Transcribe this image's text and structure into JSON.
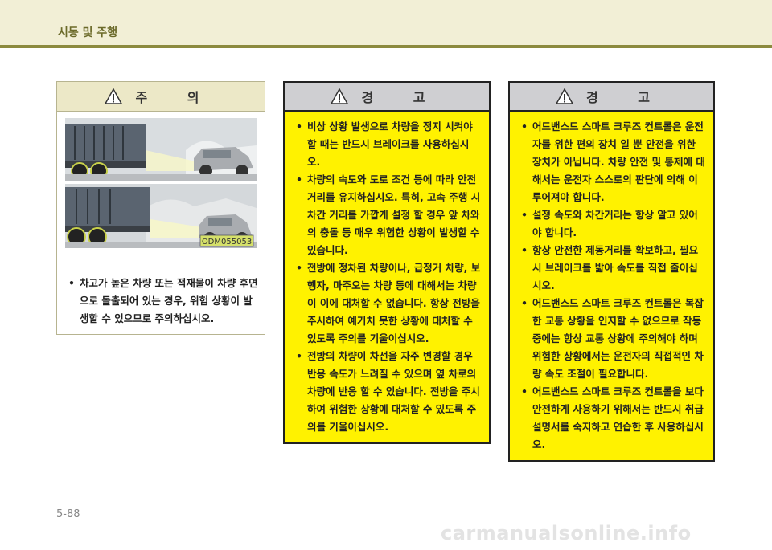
{
  "header": {
    "section_title": "시동 및 주행"
  },
  "caution": {
    "title": "주 의",
    "image_code": "ODM055053",
    "items": [
      "차고가 높은 차량 또는 적재물이 차량 후면으로 돌출되어 있는 경우, 위험 상황이 발생할 수 있으므로 주의하십시오."
    ]
  },
  "warning1": {
    "title": "경 고",
    "items": [
      "비상 상황 발생으로 차량을 정지 시켜야 할 때는 반드시 브레이크를 사용하십시오.",
      "차량의 속도와 도로 조건 등에 따라 안전거리를 유지하십시오. 특히, 고속 주행 시 차간 거리를 가깝게 설정 할 경우 앞 차와의 충돌 등 매우 위험한 상황이 발생할 수 있습니다.",
      "전방에 정차된 차량이나, 급정거 차량, 보행자, 마주오는 차량 등에 대해서는 차량이 이에 대처할 수 없습니다. 항상 전방을 주시하여 예기치 못한 상황에 대처할 수 있도록 주의를 기울이십시오.",
      "전방의 차량이 차선을 자주 변경할 경우 반응 속도가 느려질 수 있으며 옆 차로의 차량에 반응 할 수 있습니다. 전방을 주시하여 위험한 상황에 대처할 수 있도록 주의를 기울이십시오."
    ]
  },
  "warning2": {
    "title": "경 고",
    "items": [
      "어드밴스드 스마트 크루즈 컨트롤은 운전자를 위한 편의 장치 일 뿐 안전을 위한 장치가 아닙니다. 차량 안전 및 통제에 대해서는 운전자 스스로의 판단에 의해 이루어져야 합니다.",
      "설정 속도와 차간거리는 항상 알고 있어야 합니다.",
      "항상 안전한 제동거리를 확보하고, 필요시 브레이크를 밟아 속도를 직접 줄이십시오.",
      "어드밴스드 스마트 크루즈 컨트롤은 복잡한 교통 상황을 인지할 수 없으므로 작동중에는 항상 교통 상황에 주의해야 하며 위험한 상황에서는 운전자의 직접적인 차량 속도 조절이 필요합니다.",
      "어드밴스드 스마트 크루즈 컨트롤을 보다 안전하게 사용하기 위해서는 반드시 취급설명서를 숙지하고 연습한 후 사용하십시오."
    ]
  },
  "footer": {
    "page_number": "5-88",
    "watermark": "carmanualsonline.info"
  },
  "colors": {
    "warning_bg": "#fff200",
    "caution_header": "#ece8c7",
    "header_rule": "#8c8a3e"
  }
}
